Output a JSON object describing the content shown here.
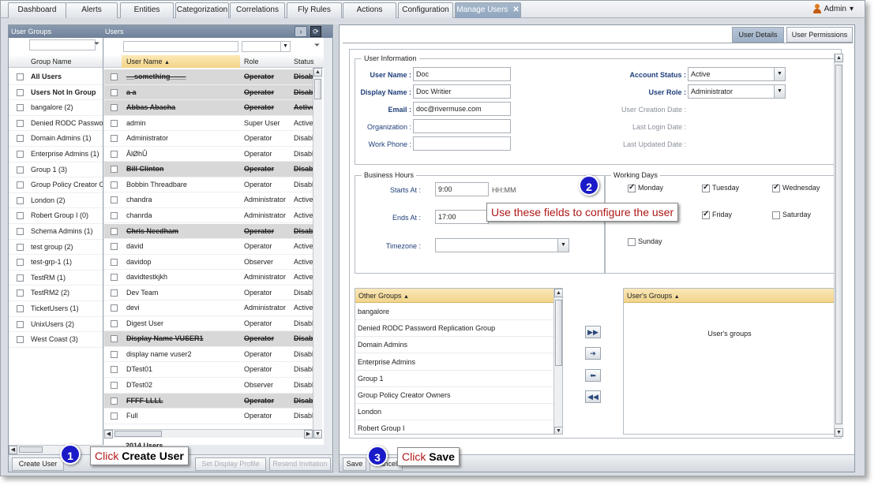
{
  "tabs": [
    {
      "label": "Dashboard"
    },
    {
      "label": "Alerts"
    },
    {
      "label": "Entities"
    },
    {
      "label": "Categorization"
    },
    {
      "label": "Correlations"
    },
    {
      "label": "Fly Rules"
    },
    {
      "label": "Actions"
    },
    {
      "label": "Configuration"
    },
    {
      "label": "Manage Users",
      "close": "✕"
    }
  ],
  "account": {
    "name": "Admin",
    "caret": "▾"
  },
  "left_header": {
    "groups_title": "User Groups",
    "users_title": "Users",
    "nav_icon": "›"
  },
  "groups": {
    "column": "Group Name",
    "items": [
      {
        "label": "All Users",
        "bold": true
      },
      {
        "label": "Users Not In Group",
        "bold": true
      },
      {
        "label": "bangalore (2)"
      },
      {
        "label": "Denied RODC Password Replication Group"
      },
      {
        "label": "Domain Admins (1)"
      },
      {
        "label": "Enterprise Admins (1)"
      },
      {
        "label": "Group 1 (3)"
      },
      {
        "label": "Group Policy Creator Owners"
      },
      {
        "label": "London (2)"
      },
      {
        "label": "Robert Group I (0)"
      },
      {
        "label": "Schema Admins (1)"
      },
      {
        "label": "test group (2)"
      },
      {
        "label": "test-grp-1 (1)"
      },
      {
        "label": "TestRM (1)"
      },
      {
        "label": "TestRM2 (2)"
      },
      {
        "label": "TicketUsers (1)"
      },
      {
        "label": "UnixUsers (2)"
      },
      {
        "label": "West Coast (3)"
      }
    ]
  },
  "users": {
    "columns": {
      "name": "User Name",
      "sort": "▲",
      "role": "Role",
      "status": "Status"
    },
    "rows": [
      {
        "name": "__something____",
        "role": "Operator",
        "status": "Disabled",
        "deleted": true
      },
      {
        "name": "a a",
        "role": "Operator",
        "status": "Disabled",
        "deleted": true
      },
      {
        "name": "Abbas Abacha",
        "role": "Operator",
        "status": "Active",
        "deleted": true
      },
      {
        "name": "admin",
        "role": "Super User",
        "status": "Active"
      },
      {
        "name": "Administrator",
        "role": "Operator",
        "status": "Disabled"
      },
      {
        "name": "ÂlØhÛ",
        "role": "Operator",
        "status": "Disabled"
      },
      {
        "name": "Bill Clinton",
        "role": "Operator",
        "status": "Disabled",
        "deleted": true
      },
      {
        "name": "Bobbin Threadbare",
        "role": "Operator",
        "status": "Disabled"
      },
      {
        "name": "chandra",
        "role": "Administrator",
        "status": "Active"
      },
      {
        "name": "chanrda",
        "role": "Administrator",
        "status": "Active"
      },
      {
        "name": "Chris Needham",
        "role": "Operator",
        "status": "Disabled",
        "deleted": true
      },
      {
        "name": "david",
        "role": "Operator",
        "status": "Active"
      },
      {
        "name": "davidop",
        "role": "Observer",
        "status": "Active"
      },
      {
        "name": "davidtestkjkh",
        "role": "Administrator",
        "status": "Active"
      },
      {
        "name": "Dev Team",
        "role": "Operator",
        "status": "Disabled"
      },
      {
        "name": "devi",
        "role": "Administrator",
        "status": "Active"
      },
      {
        "name": "Digest User",
        "role": "Operator",
        "status": "Disabled"
      },
      {
        "name": "Display Name VUSER1",
        "role": "Operator",
        "status": "Disabled",
        "deleted": true
      },
      {
        "name": "display name vuser2",
        "role": "Operator",
        "status": "Disabled"
      },
      {
        "name": "DTest01",
        "role": "Operator",
        "status": "Disabled"
      },
      {
        "name": "DTest02",
        "role": "Observer",
        "status": "Disabled"
      },
      {
        "name": "FFFF LLLL",
        "role": "Operator",
        "status": "Disabled",
        "deleted": true
      },
      {
        "name": "Full",
        "role": "Operator",
        "status": "Disabled"
      }
    ],
    "count": "2014 Users"
  },
  "left_buttons": {
    "create": "Create User",
    "set_display": "Set Display Profile",
    "resend": "Resend Invitation"
  },
  "right_tabs": {
    "details": "User Details",
    "permissions": "User Permissions"
  },
  "user_info": {
    "legend": "User Information",
    "user_name_label": "User Name :",
    "user_name": "Doc",
    "display_name_label": "Display Name :",
    "display_name": "Doc Writier",
    "email_label": "Email :",
    "email": "doc@rivermuse.com",
    "organization_label": "Organization :",
    "organization": "",
    "work_phone_label": "Work Phone :",
    "work_phone": "",
    "account_status_label": "Account Status :",
    "account_status": "Active",
    "user_role_label": "User Role :",
    "user_role": "Administrator",
    "creation_label": "User Creation Date :",
    "last_login_label": "Last Login Date :",
    "last_updated_label": "Last Updated Date :"
  },
  "business_hours": {
    "legend": "Business Hours",
    "starts_label": "Starts At :",
    "starts": "9:00",
    "format": "HH:MM",
    "ends_label": "Ends At :",
    "ends": "17:00",
    "timezone_label": "Timezone :",
    "timezone": ""
  },
  "working_days": {
    "legend": "Working Days",
    "days": [
      {
        "label": "Monday",
        "checked": true
      },
      {
        "label": "Tuesday",
        "checked": true
      },
      {
        "label": "Wednesday",
        "checked": true
      },
      {
        "label": "Friday",
        "checked": true
      },
      {
        "label": "Saturday",
        "checked": false
      },
      {
        "label": "Sunday",
        "checked": false
      }
    ]
  },
  "other_groups": {
    "title": "Other Groups",
    "sort": "▲",
    "items": [
      "bangalore",
      "Denied RODC Password Replication Group",
      "Domain Admins",
      "Enterprise Admins",
      "Group 1",
      "Group Policy Creator Owners",
      "London",
      "Robert Group I"
    ]
  },
  "users_groups": {
    "title": "User's Groups",
    "sort": "▲",
    "empty": "User's groups"
  },
  "move_buttons": [
    "▶▶",
    "➔",
    "⬅",
    "◀◀"
  ],
  "right_buttons": {
    "save": "Save",
    "cancel": "Cancel"
  },
  "callouts": {
    "c1_num": "1",
    "c1_pre": "Click ",
    "c1_bold": "Create User",
    "c2_num": "2",
    "c2_text": "Use these fields to configure the user",
    "c3_num": "3",
    "c3_pre": "Click ",
    "c3_bold": "Save"
  },
  "colors": {
    "accent": "#1a1ac8",
    "callout_text": "#b01818",
    "header": "#7a8ca3",
    "list_header": "#f1d48c"
  }
}
